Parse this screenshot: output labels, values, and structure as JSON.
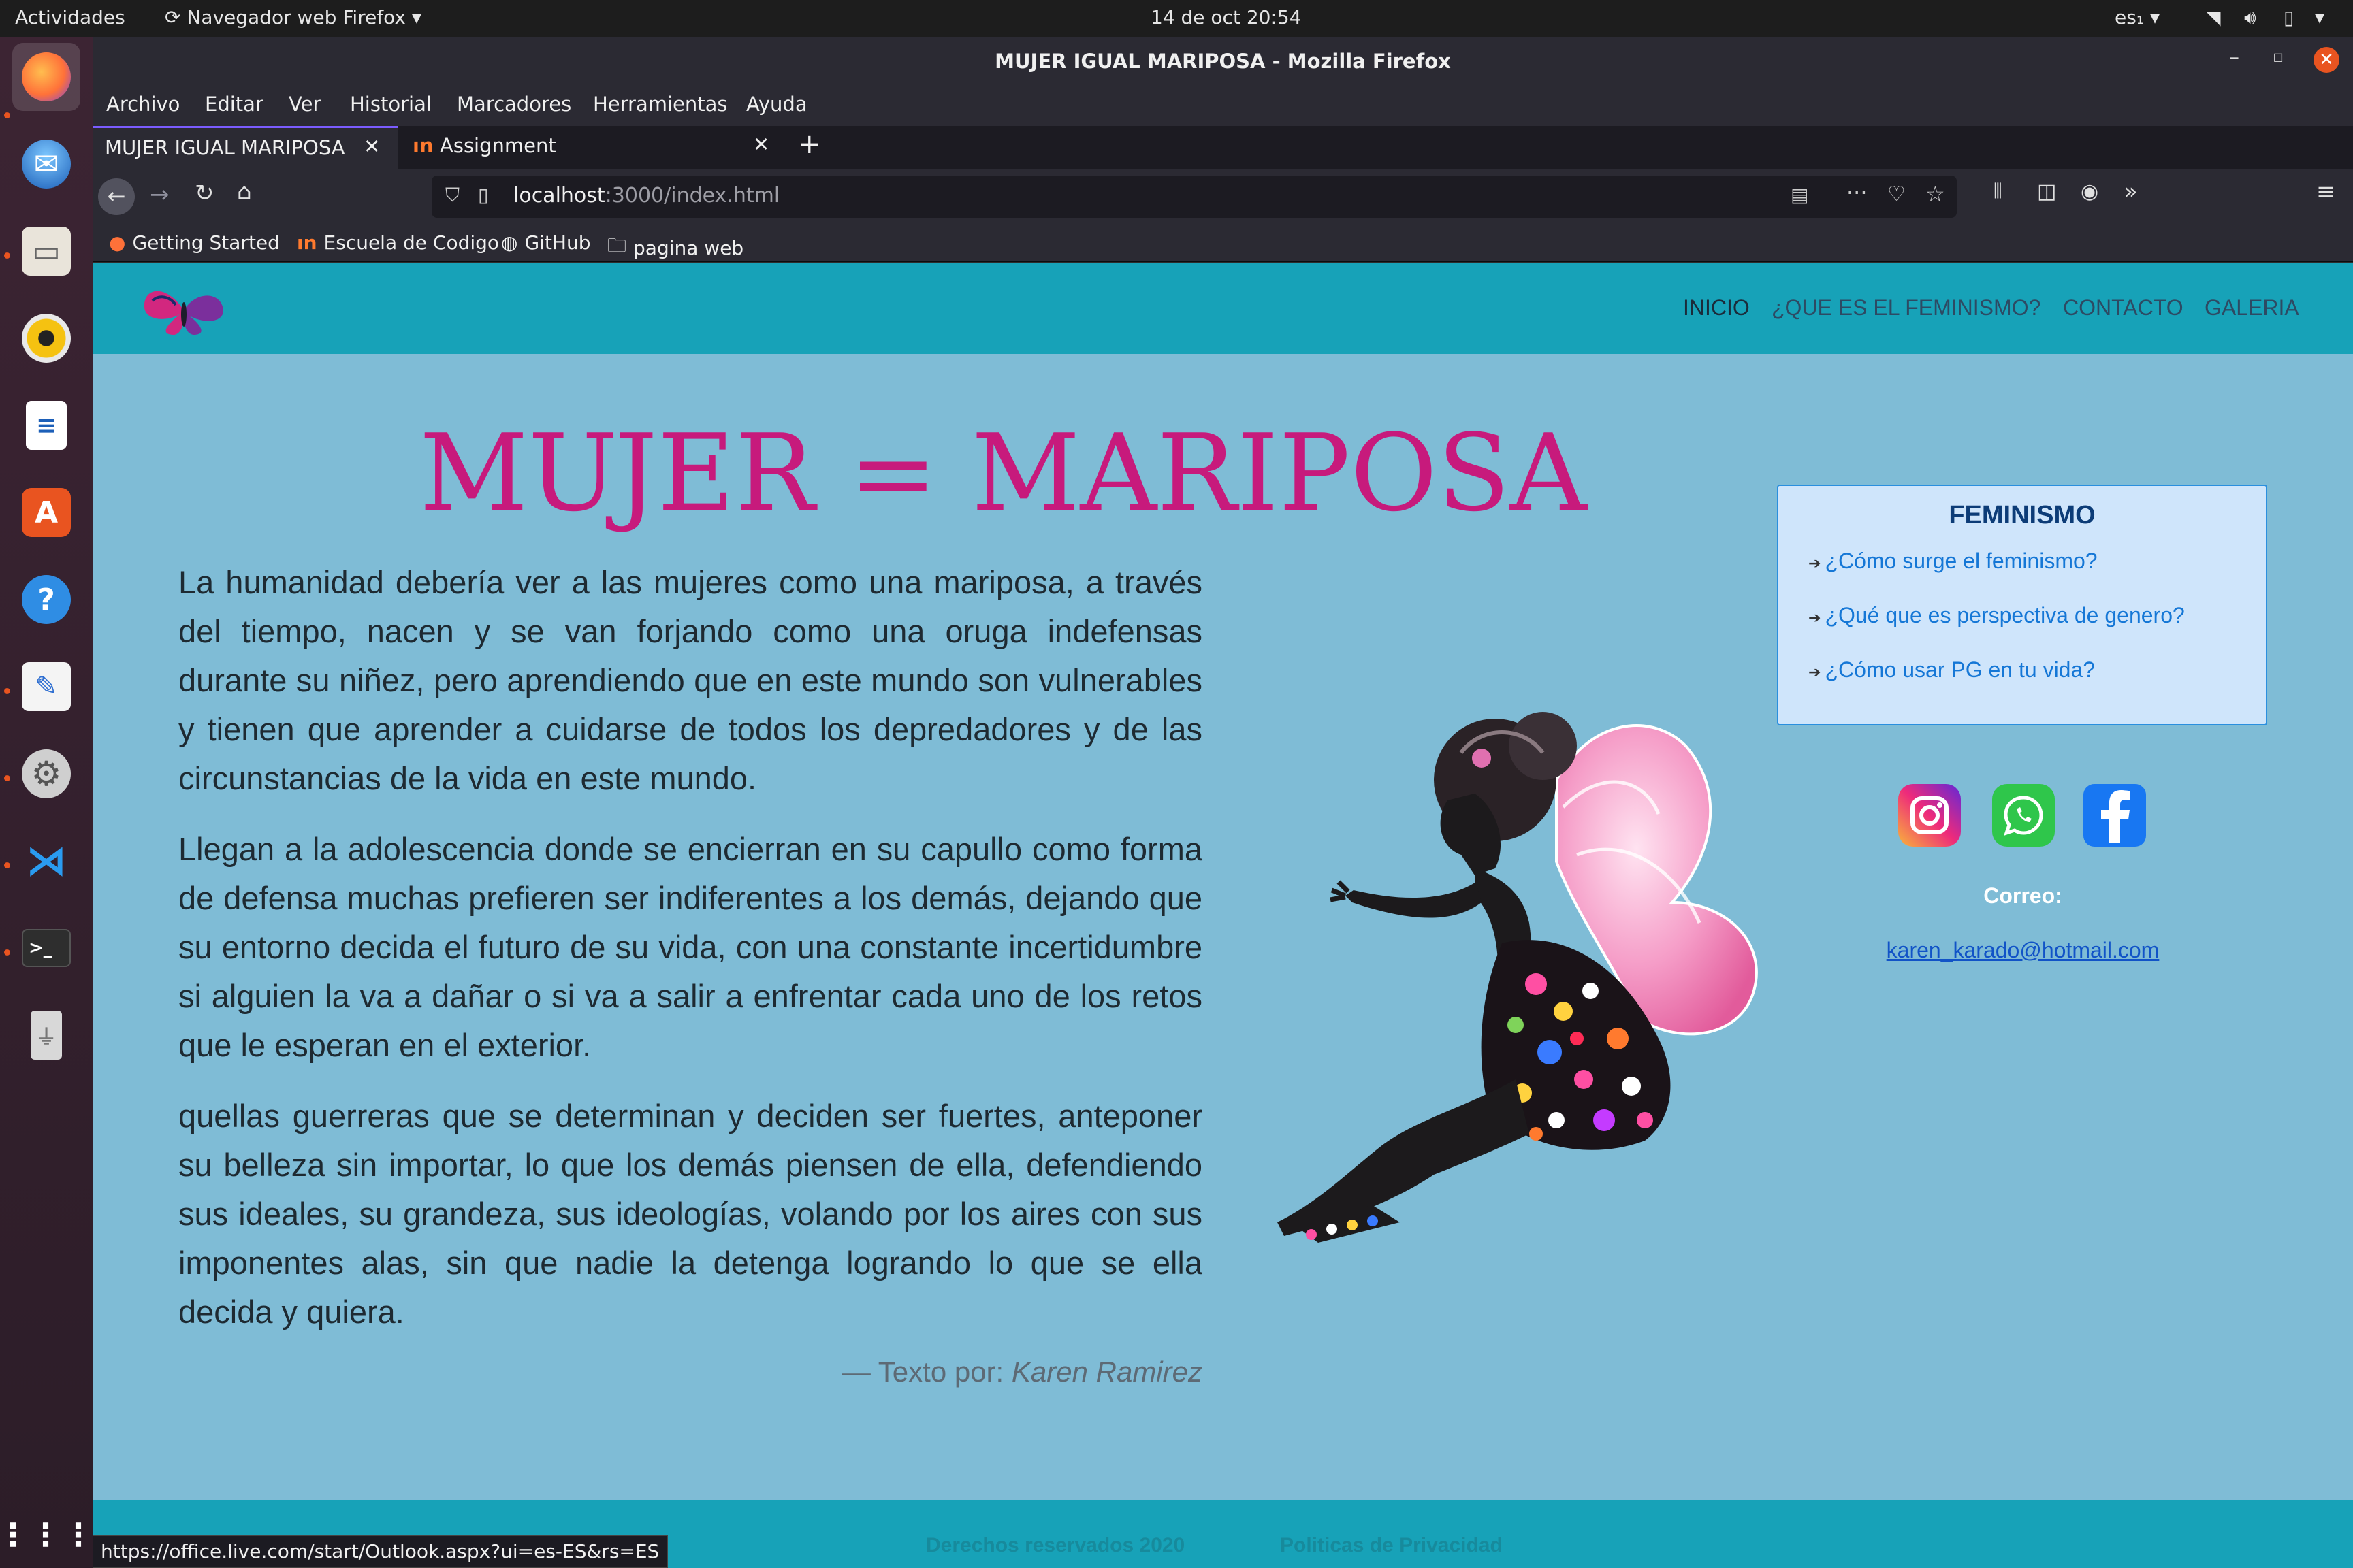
{
  "os": {
    "activities": "Actividades",
    "app_name": "Navegador web Firefox",
    "clock": "14 de oct  20:54",
    "lang": "es₁"
  },
  "window": {
    "title": "MUJER IGUAL MARIPOSA - Mozilla Firefox"
  },
  "menu": [
    "Archivo",
    "Editar",
    "Ver",
    "Historial",
    "Marcadores",
    "Herramientas",
    "Ayuda"
  ],
  "tabs": [
    {
      "label": "MUJER IGUAL MARIPOSA",
      "active": true
    },
    {
      "label": "Assignment",
      "active": false
    }
  ],
  "url": {
    "host": "localhost",
    "path": ":3000/index.html"
  },
  "bookmarks": [
    "Getting Started",
    "Escuela de Codigo",
    "GitHub",
    "pagina web"
  ],
  "site": {
    "nav": [
      "INICIO",
      "¿QUE ES EL FEMINISMO?",
      "CONTACTO",
      "GALERIA"
    ],
    "title": "MUJER = MARIPOSA",
    "paragraphs": [
      "La humanidad debería ver a las mujeres como una mariposa, a través del tiempo, nacen y se van forjando como una oruga indefensas durante su niñez, pero aprendiendo que en este mundo son vulnerables y tienen que aprender a cuidarse de todos los depredadores y de las circunstancias de la vida en este mundo.",
      "Llegan a la adolescencia donde se encierran en su capullo como forma de defensa muchas prefieren ser indiferentes a los demás, dejando que su entorno decida el futuro de su vida, con una constante incertidumbre si alguien la va a dañar o si va a salir a enfrentar cada uno de los retos que le esperan en el exterior.",
      "quellas guerreras que se determinan y deciden ser fuertes, anteponer su belleza sin importar, lo que los demás piensen de ella, defendiendo sus ideales, su grandeza, sus ideologías, volando por los aires con sus imponentes alas, sin que nadie la detenga logrando lo que se ella decida y quiera."
    ],
    "quote_prefix": "— Texto por: ",
    "quote_author": "Karen Ramirez",
    "sidebar": {
      "title": "FEMINISMO",
      "links": [
        "¿Cómo surge el feminismo?",
        "¿Qué que es perspectiva de genero?",
        "¿Cómo usar PG en tu vida?"
      ]
    },
    "correo_label": "Correo:",
    "correo": "karen_karado@hotmail.com",
    "footer": [
      "Derechos reservados 2020",
      "Politicas de Privacidad"
    ]
  },
  "status_url": "https://office.live.com/start/Outlook.aspx?ui=es-ES&rs=ES",
  "colors": {
    "page_bg": "#7fbcd6",
    "header_bg": "#17a2b8",
    "title_pink": "#c71a7c",
    "sidebar_bg": "#cfe5fb",
    "link_blue": "#1577d6"
  }
}
